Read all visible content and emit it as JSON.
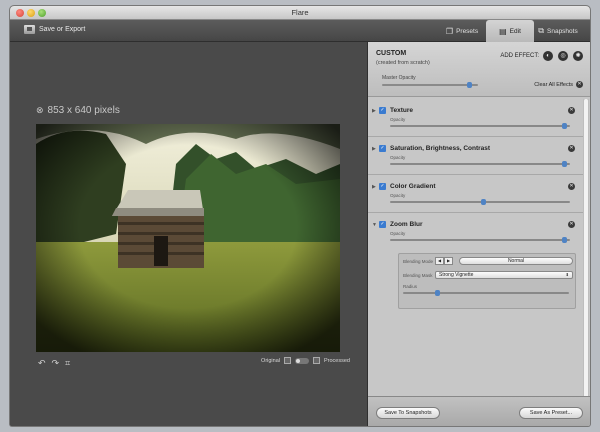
{
  "window": {
    "title": "Flare"
  },
  "toolbar": {
    "save_export_label": "Save or Export",
    "tabs": [
      {
        "label": "Presets",
        "icon": "presets-icon",
        "active": false
      },
      {
        "label": "Edit",
        "icon": "edit-icon",
        "active": true
      },
      {
        "label": "Snapshots",
        "icon": "snapshots-icon",
        "active": false
      }
    ]
  },
  "canvas": {
    "image_size": "853 x 640 pixels",
    "tools": [
      "undo-icon",
      "redo-icon",
      "crop-icon"
    ],
    "compare": {
      "original_label": "Original",
      "processed_label": "Processed"
    }
  },
  "panel": {
    "preset_title": "CUSTOM",
    "preset_subtitle": "(created from scratch)",
    "add_effect_label": "ADD EFFECT:",
    "master_opacity_label": "Master Opacity",
    "master_opacity": 0.93,
    "clear_all_label": "Clear All Effects",
    "effects": [
      {
        "name": "Texture",
        "enabled": true,
        "slider_label": "Opacity",
        "value": 0.98
      },
      {
        "name": "Saturation, Brightness, Contrast",
        "enabled": true,
        "slider_label": "Opacity",
        "value": 0.98
      },
      {
        "name": "Color Gradient",
        "enabled": true,
        "slider_label": "Opacity",
        "value": 0.52
      },
      {
        "name": "Zoom Blur",
        "enabled": true,
        "slider_label": "Opacity",
        "value": 0.98
      }
    ],
    "zoom_blur_options": {
      "blending_mode_label": "Blending Mode",
      "blending_mode_value": "Normal",
      "blending_mask_label": "Blending Mask",
      "blending_mask_value": "Strong Vignette",
      "radius_label": "Radius",
      "radius_value": 0.2
    },
    "footer": {
      "save_snapshot_label": "Save To Snapshots",
      "save_preset_label": "Save As Preset..."
    }
  },
  "colors": {
    "accent": "#4f83c4",
    "panel_bg": "#c7c7c7",
    "canvas_bg": "#4a4a4a"
  }
}
